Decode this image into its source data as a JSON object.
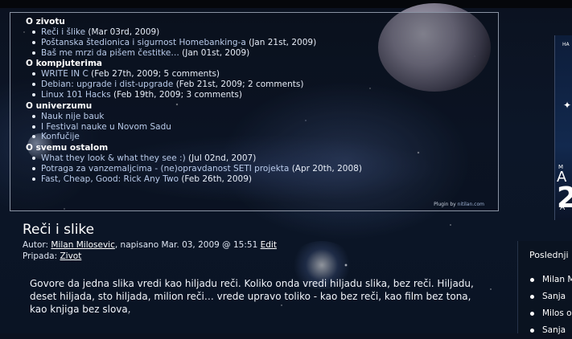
{
  "recent_posts": {
    "categories": [
      {
        "title": "O zivotu",
        "posts": [
          {
            "title": "Reči i šlike",
            "meta": " (Mar 03rd, 2009)"
          },
          {
            "title": "Poštanska štedionica i sigurnost Homebanking-a",
            "meta": " (Jan 21st, 2009)"
          },
          {
            "title": "Baš me mrzi da pišem čestitke…",
            "meta": " (Jan 01st, 2009)"
          }
        ]
      },
      {
        "title": "O kompjuterima",
        "posts": [
          {
            "title": "WRITE IN C",
            "meta": " (Feb 27th, 2009; 5 comments)"
          },
          {
            "title": "Debian: upgrade i dist-upgrade",
            "meta": " (Feb 21st, 2009; 2 comments)"
          },
          {
            "title": "Linux 101 Hacks",
            "meta": " (Feb 19th, 2009; 3 comments)"
          }
        ]
      },
      {
        "title": "O univerzumu",
        "posts": [
          {
            "title": "Nauk nije bauk",
            "meta": ""
          },
          {
            "title": "I Festival nauke u Novom Sadu",
            "meta": ""
          },
          {
            "title": "Konfučije",
            "meta": ""
          }
        ]
      },
      {
        "title": "O svemu ostalom",
        "posts": [
          {
            "title": "What they look & what they see :)",
            "meta": " (Jul 02nd, 2007)"
          },
          {
            "title": "Potraga za vanzemaljcima - (ne)opravdanost SETI projekta",
            "meta": " (Apr 20th, 2008)"
          },
          {
            "title": "Fast, Cheap, Good: Rick Any Two",
            "meta": " (Feb 26th, 2009)"
          }
        ]
      }
    ],
    "plugin_credit_prefix": "Plugin by ",
    "plugin_credit_link": "nitilan.com"
  },
  "post": {
    "title": "Reči i slike",
    "author_prefix": "Autor: ",
    "author": "Milan Milosevic",
    "date_text": ", napisano Mar. 03, 2009 @ 15:51 ",
    "edit_label": "Edit",
    "category_prefix": "Pripada: ",
    "category": "Zivot",
    "body": "Govore da jedna slika vredi kao hiljadu reči. Koliko onda vredi hiljadu slika, bez reči. Hiljadu, deset hiljada, sto hiljada, milion reči… vrede upravo toliko - kao bez reči, kao film bez tona, kao knjiga bez slova."
  },
  "sidebar": {
    "logo_text_top": "HA",
    "logo_text_m": "M",
    "logo_text_a": "A",
    "logo_text_big": "2",
    "logo_text_bottom": "A",
    "latest_title": "Poslednji k",
    "latest_items": [
      "Milan M",
      "Sanja",
      "Milos o",
      "Sanja"
    ]
  }
}
